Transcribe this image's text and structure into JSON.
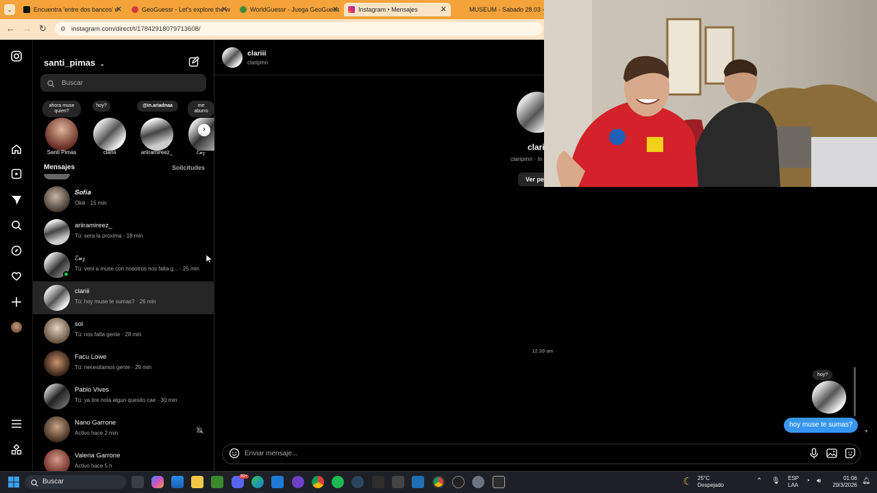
{
  "browser": {
    "tabs": [
      {
        "title": "Encuentra 'entre dos bancos' e",
        "favicon_color": "#111111"
      },
      {
        "title": "GeoGuessr - Let's explore the w",
        "favicon_color": "#d23c3c"
      },
      {
        "title": "WorldGuessr - Juega GeoGuess",
        "favicon_color": "#3b8a3b"
      },
      {
        "title": "Instagram • Mensajes",
        "favicon_color": "#d6249f"
      },
      {
        "title": "MUSEUM - Sabado 28.03 - Cu",
        "favicon_color": "#f3a33a"
      }
    ],
    "url": "instagram.com/direct/t/17842918079713608/",
    "tab_close": "✕"
  },
  "sidebar": {
    "username": "santi_pimas",
    "search_placeholder": "Buscar",
    "notes": [
      {
        "text": "ahora muse quien?",
        "name": "Santi Pimas"
      },
      {
        "text": "hoy?",
        "name": "clariii"
      },
      {
        "text": "@in.ariadnaa",
        "name": "ariiramireez_"
      },
      {
        "text": "me aburro",
        "name": "ℰ𝓊𝓏"
      }
    ],
    "mensajes_label": "Mensajes",
    "solicitudes_label": "Solicitudes",
    "conversations": [
      {
        "name": "𝑺𝒐𝒇𝒊𝒂",
        "msg": "Okiii · 15 min",
        "color": "#8a7c70"
      },
      {
        "name": "ariiramireez_",
        "msg": "Tú: sera la proxima · 18 min",
        "color": "#9a9a9a"
      },
      {
        "name": "ℰ𝓊𝓏",
        "msg": "Tú: veni a muse con nosotros nos falta g... · 25 min",
        "color": "#777777"
      },
      {
        "name": "clariii",
        "msg": "Tú: hoy muse te sumas? · 26 min",
        "color": "#8f8f8f"
      },
      {
        "name": "sol",
        "msg": "Tú: nos falta gente · 28 min",
        "color": "#7f7466"
      },
      {
        "name": "Facu Lowe",
        "msg": "Tú: necesitamos gente · 29 min",
        "color": "#5e4a3c"
      },
      {
        "name": "Pablo Vives",
        "msg": "Tú: ya tire nota algun quesito cae · 30 min",
        "color": "#6b6b6b"
      },
      {
        "name": "Nano Garrone",
        "msg": "Activo hace 2 min",
        "color": "#6e5a48"
      },
      {
        "name": "Valeria Garrone",
        "msg": "Activo hace 5 h",
        "color": "#a55d5d"
      }
    ]
  },
  "chat": {
    "name": "clariii",
    "handle": "claripmn",
    "profile_name": "clari",
    "profile_sub": "claripmn · In",
    "profile_button": "Ver pe",
    "timestamp": "12:39 am",
    "note_reply": "hoy?",
    "last_message": "hoy muse te sumas?",
    "composer_placeholder": "Enviar mensaje..."
  },
  "taskbar": {
    "search_label": "Buscar",
    "weather_temp": "25°C",
    "weather_desc": "Despejado",
    "lang_top": "ESP",
    "lang_bottom": "LAA",
    "time": "01:06",
    "date": "29/3/2026",
    "discord_badge": "99+"
  }
}
